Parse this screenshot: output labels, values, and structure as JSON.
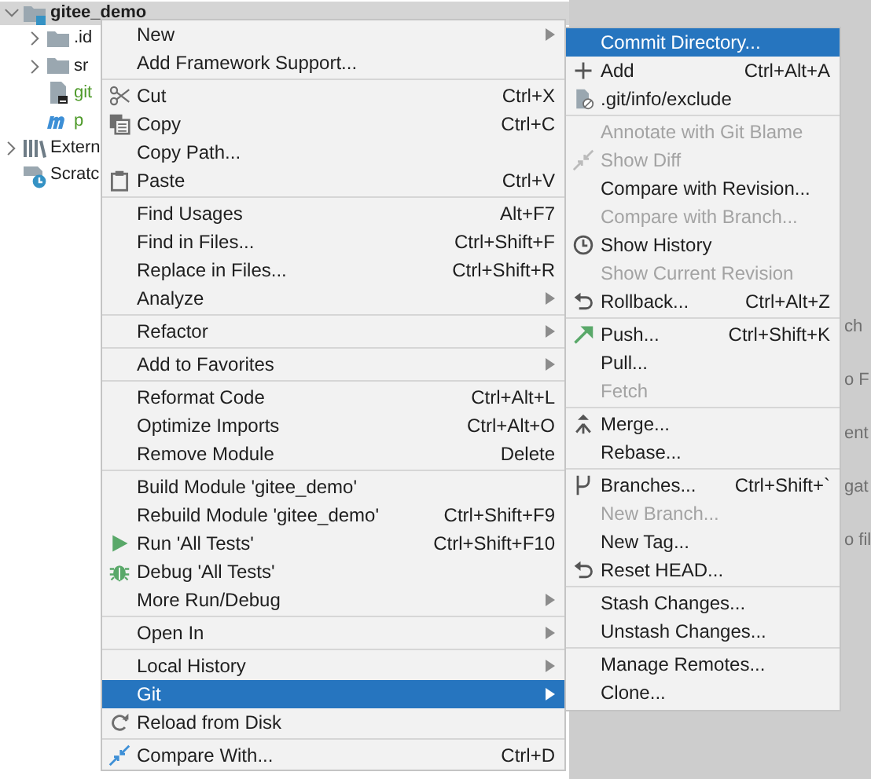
{
  "project_tree": [
    {
      "label": "gitee_demo",
      "kind": "folder",
      "expanded": true,
      "selected": true,
      "children": [
        {
          "label": ".id",
          "kind": "folder",
          "expanded": false,
          "selected": false
        },
        {
          "label": "sr",
          "kind": "folder",
          "expanded": false,
          "selected": false
        },
        {
          "label": "git",
          "kind": "file",
          "selected": false,
          "color": "#4e9a2a"
        },
        {
          "label": "p",
          "kind": "file",
          "selected": false,
          "color": "#4e9a2a"
        }
      ]
    },
    {
      "label": "Extern",
      "kind": "folder",
      "expanded": false,
      "selected": false
    },
    {
      "label": "Scratc",
      "kind": "file",
      "selected": false
    }
  ],
  "editor_hints": [
    "ch",
    "o F",
    "ent",
    "gat",
    "o fil"
  ],
  "context_menu": {
    "groups": [
      [
        {
          "label": "New",
          "has_submenu": true,
          "selected": false
        },
        {
          "label": "Add Framework Support...",
          "has_submenu": false,
          "selected": false
        }
      ],
      [
        {
          "label": "Cut",
          "shortcut": "Ctrl+X",
          "has_submenu": false,
          "selected": false
        },
        {
          "label": "Copy",
          "shortcut": "Ctrl+C",
          "has_submenu": false,
          "selected": false
        },
        {
          "label": "Copy Path...",
          "has_submenu": false,
          "selected": false
        },
        {
          "label": "Paste",
          "shortcut": "Ctrl+V",
          "has_submenu": false,
          "selected": false
        }
      ],
      [
        {
          "label": "Find Usages",
          "shortcut": "Alt+F7",
          "has_submenu": false,
          "selected": false
        },
        {
          "label": "Find in Files...",
          "shortcut": "Ctrl+Shift+F",
          "has_submenu": false,
          "selected": false
        },
        {
          "label": "Replace in Files...",
          "shortcut": "Ctrl+Shift+R",
          "has_submenu": false,
          "selected": false
        },
        {
          "label": "Analyze",
          "has_submenu": true,
          "selected": false
        }
      ],
      [
        {
          "label": "Refactor",
          "has_submenu": true,
          "selected": false
        }
      ],
      [
        {
          "label": "Add to Favorites",
          "has_submenu": true,
          "selected": false
        }
      ],
      [
        {
          "label": "Reformat Code",
          "shortcut": "Ctrl+Alt+L",
          "has_submenu": false,
          "selected": false
        },
        {
          "label": "Optimize Imports",
          "shortcut": "Ctrl+Alt+O",
          "has_submenu": false,
          "selected": false
        },
        {
          "label": "Remove Module",
          "shortcut": "Delete",
          "has_submenu": false,
          "selected": false
        }
      ],
      [
        {
          "label": "Build Module 'gitee_demo'",
          "has_submenu": false,
          "selected": false
        },
        {
          "label": "Rebuild Module 'gitee_demo'",
          "shortcut": "Ctrl+Shift+F9",
          "has_submenu": false,
          "selected": false
        },
        {
          "label": "Run 'All Tests'",
          "shortcut": "Ctrl+Shift+F10",
          "has_submenu": false,
          "selected": false
        },
        {
          "label": "Debug 'All Tests'",
          "has_submenu": false,
          "selected": false
        },
        {
          "label": "More Run/Debug",
          "has_submenu": true,
          "selected": false
        }
      ],
      [
        {
          "label": "Open In",
          "has_submenu": true,
          "selected": false
        }
      ],
      [
        {
          "label": "Local History",
          "has_submenu": true,
          "selected": false
        },
        {
          "label": "Git",
          "has_submenu": true,
          "selected": true
        },
        {
          "label": "Reload from Disk",
          "has_submenu": false,
          "selected": false
        }
      ],
      [
        {
          "label": "Compare With...",
          "shortcut": "Ctrl+D",
          "has_submenu": false,
          "selected": false
        }
      ]
    ]
  },
  "git_submenu": {
    "groups": [
      [
        {
          "label": "Commit Directory...",
          "selected": true,
          "disabled": false
        },
        {
          "label": "Add",
          "shortcut": "Ctrl+Alt+A",
          "selected": false,
          "disabled": false
        },
        {
          "label": ".git/info/exclude",
          "selected": false,
          "disabled": false
        }
      ],
      [
        {
          "label": "Annotate with Git Blame",
          "selected": false,
          "disabled": true
        },
        {
          "label": "Show Diff",
          "selected": false,
          "disabled": true
        },
        {
          "label": "Compare with Revision...",
          "selected": false,
          "disabled": false
        },
        {
          "label": "Compare with Branch...",
          "selected": false,
          "disabled": true
        },
        {
          "label": "Show History",
          "selected": false,
          "disabled": false
        },
        {
          "label": "Show Current Revision",
          "selected": false,
          "disabled": true
        },
        {
          "label": "Rollback...",
          "shortcut": "Ctrl+Alt+Z",
          "selected": false,
          "disabled": false
        }
      ],
      [
        {
          "label": "Push...",
          "shortcut": "Ctrl+Shift+K",
          "selected": false,
          "disabled": false
        },
        {
          "label": "Pull...",
          "selected": false,
          "disabled": false
        },
        {
          "label": "Fetch",
          "selected": false,
          "disabled": true
        }
      ],
      [
        {
          "label": "Merge...",
          "selected": false,
          "disabled": false
        },
        {
          "label": "Rebase...",
          "selected": false,
          "disabled": false
        }
      ],
      [
        {
          "label": "Branches...",
          "shortcut": "Ctrl+Shift+`",
          "selected": false,
          "disabled": false
        },
        {
          "label": "New Branch...",
          "selected": false,
          "disabled": true
        },
        {
          "label": "New Tag...",
          "selected": false,
          "disabled": false
        },
        {
          "label": "Reset HEAD...",
          "selected": false,
          "disabled": false
        }
      ],
      [
        {
          "label": "Stash Changes...",
          "selected": false,
          "disabled": false
        },
        {
          "label": "Unstash Changes...",
          "selected": false,
          "disabled": false
        }
      ],
      [
        {
          "label": "Manage Remotes...",
          "selected": false,
          "disabled": false
        },
        {
          "label": "Clone...",
          "selected": false,
          "disabled": false
        }
      ]
    ]
  }
}
